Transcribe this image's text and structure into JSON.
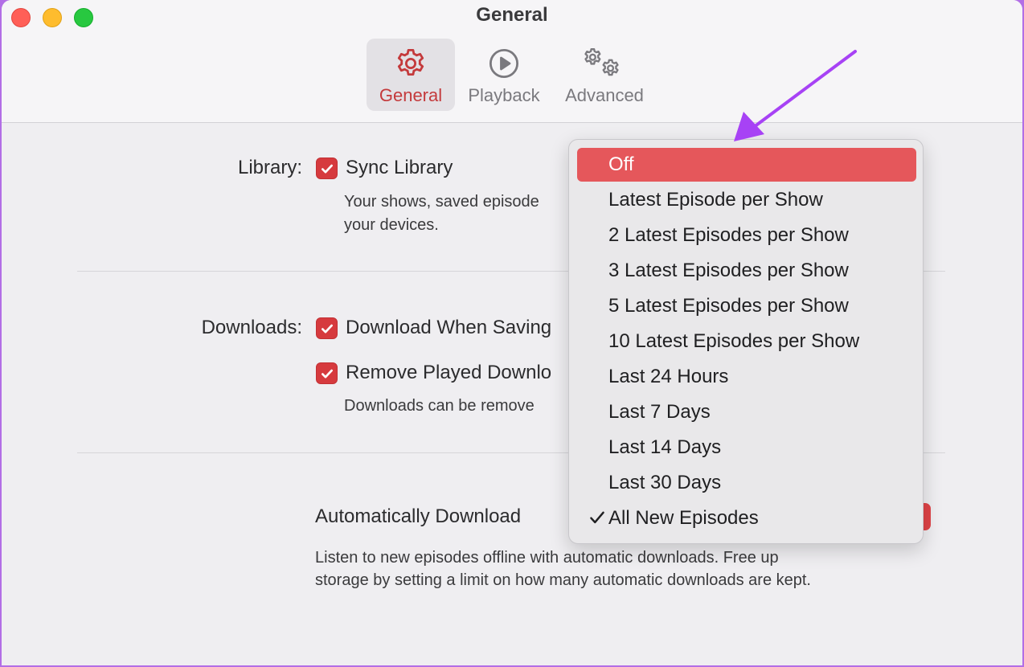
{
  "window": {
    "title": "General"
  },
  "tabs": [
    {
      "label": "General",
      "icon": "gear-icon",
      "active": true
    },
    {
      "label": "Playback",
      "icon": "play-circle-icon",
      "active": false
    },
    {
      "label": "Advanced",
      "icon": "gears-icon",
      "active": false
    }
  ],
  "library": {
    "label": "Library:",
    "sync_label": "Sync Library",
    "sync_checked": true,
    "desc_line1": "Your shows, saved episode",
    "desc_line2": "your devices."
  },
  "downloads": {
    "label": "Downloads:",
    "download_when_saving_label": "Download When Saving",
    "download_when_saving_checked": true,
    "remove_played_label": "Remove Played Downlo",
    "remove_played_checked": true,
    "desc": "Downloads can be remove"
  },
  "auto_download": {
    "label": "Automatically Download",
    "desc_line1": "Listen to new episodes offline with automatic downloads. Free up",
    "desc_line2": "storage by setting a limit on how many automatic downloads are kept."
  },
  "menu": {
    "items": [
      {
        "label": "Off",
        "highlighted": true,
        "checked": false
      },
      {
        "label": "Latest Episode per Show",
        "highlighted": false,
        "checked": false
      },
      {
        "label": "2 Latest Episodes per Show",
        "highlighted": false,
        "checked": false
      },
      {
        "label": "3 Latest Episodes per Show",
        "highlighted": false,
        "checked": false
      },
      {
        "label": "5 Latest Episodes per Show",
        "highlighted": false,
        "checked": false
      },
      {
        "label": "10 Latest Episodes per Show",
        "highlighted": false,
        "checked": false
      },
      {
        "label": "Last 24 Hours",
        "highlighted": false,
        "checked": false
      },
      {
        "label": "Last 7 Days",
        "highlighted": false,
        "checked": false
      },
      {
        "label": "Last 14 Days",
        "highlighted": false,
        "checked": false
      },
      {
        "label": "Last 30 Days",
        "highlighted": false,
        "checked": false
      },
      {
        "label": "All New Episodes",
        "highlighted": false,
        "checked": true
      }
    ]
  },
  "colors": {
    "accent": "#d63a3e",
    "menu_highlight": "#e5575b",
    "annotation_arrow": "#a742f5",
    "background_frame": "#b26ee6"
  }
}
